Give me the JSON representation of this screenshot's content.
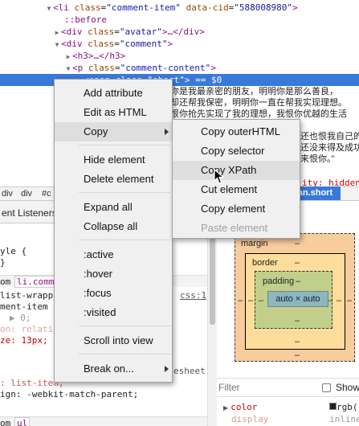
{
  "dom_tree": {
    "row1": {
      "tag": "li",
      "attr": "class",
      "val": "\"comment-item\"",
      "attr2": "data-cid",
      "val2": "\"588008980\""
    },
    "row2": "::before",
    "row3": {
      "tag": "div",
      "attr": "class",
      "val": "\"avatar\"",
      "tail": "…</div>"
    },
    "row4": {
      "tag": "div",
      "attr": "class",
      "val": "\"comment\""
    },
    "row5": "<h3>…</h3>",
    "row6": {
      "tag": "p",
      "attr": "class",
      "val": "\"comment-content\""
    },
    "row7": "<span class=\"short\"> == $0",
    "text_lines": [
      "你是我最亲密的朋友，明明你是那么善良，",
      "却还帮我保密，明明你一直在帮我实现理想。",
      "恨你抢先实现了我的理想，我恨你优越的生活",
      "还也恨我自己的",
      "还没来得及成功",
      "来恨你。”"
    ],
    "visibility_text": "ity: hidden;"
  },
  "breadcrumbs": [
    "div",
    "div",
    "#c"
  ],
  "tooltip_tag": "pan.short",
  "subtab_label": "ent Listeners",
  "styles": {
    "l1": "yle {",
    "l2": "}",
    "chip1": "om",
    "chip2": "li.comm",
    "l3": "list-wrappe",
    "l3b": "css:1",
    "l4": "ment-item {",
    "l5": "▶ 0;",
    "l6": "on: relativ",
    "l7": "ze: 13px;",
    "l8": "esheet",
    "l9": ": list-item;",
    "l10": "ign: -webkit-match-parent;",
    "chip3": "om",
    "chip4": "ul"
  },
  "box_model": {
    "margin": "margin",
    "border": "border",
    "padding": "padding",
    "content": "auto × auto",
    "dash": "–"
  },
  "filter": {
    "placeholder": "Filter",
    "show_label": "Show"
  },
  "computed": [
    {
      "prop": "color",
      "val": "rgb("
    },
    {
      "prop": "display",
      "val": "inline"
    }
  ],
  "context_menu": {
    "items": [
      {
        "label": "Add attribute"
      },
      {
        "label": "Edit as HTML"
      },
      {
        "label": "Copy"
      },
      {
        "label": "Hide element"
      },
      {
        "label": "Delete element"
      },
      {
        "label": "Expand all"
      },
      {
        "label": "Collapse all"
      },
      {
        "label": ":active"
      },
      {
        "label": ":hover"
      },
      {
        "label": ":focus"
      },
      {
        "label": ":visited"
      },
      {
        "label": "Scroll into view"
      },
      {
        "label": "Break on..."
      }
    ],
    "copy_submenu": [
      {
        "label": "Copy outerHTML"
      },
      {
        "label": "Copy selector"
      },
      {
        "label": "Copy XPath"
      },
      {
        "label": "Cut element"
      },
      {
        "label": "Copy element"
      },
      {
        "label": "Paste element"
      }
    ]
  }
}
